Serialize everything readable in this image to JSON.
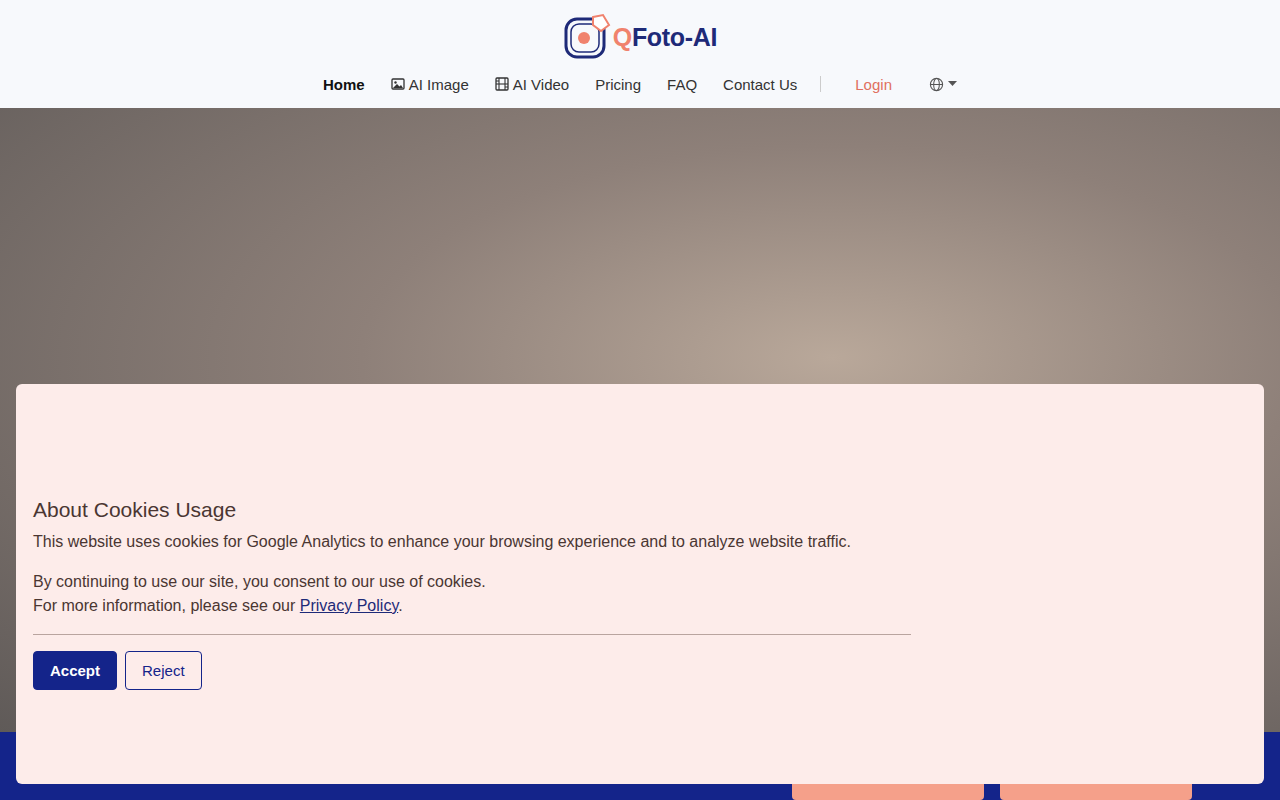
{
  "logo": {
    "parts": [
      {
        "text": "Q",
        "color": "#f0826d"
      },
      {
        "text": "Foto-AI",
        "color": "#1e2a78"
      }
    ]
  },
  "nav": {
    "items": [
      {
        "label": "Home",
        "kind": "plain",
        "selected": true
      },
      {
        "label": "AI Image",
        "kind": "image",
        "selected": false
      },
      {
        "label": "AI Video",
        "kind": "video",
        "selected": false
      },
      {
        "label": "Pricing",
        "kind": "plain",
        "selected": false
      },
      {
        "label": "FAQ",
        "kind": "plain",
        "selected": false
      },
      {
        "label": "Contact Us",
        "kind": "plain",
        "selected": false
      }
    ],
    "login": "Login"
  },
  "cookie_banner": {
    "title": "About Cookies Usage",
    "intro": "This website uses cookies for Google Analytics to enhance your browsing experience and to analyze website traffic.",
    "consent": "By continuing to use our site, you consent to our use of cookies.",
    "more_before": "For more information, please see our ",
    "link": "Privacy Policy",
    "more_after": ".",
    "buttons": [
      {
        "label": "Accept",
        "primary": true
      },
      {
        "label": "Reject",
        "primary": false
      }
    ]
  }
}
